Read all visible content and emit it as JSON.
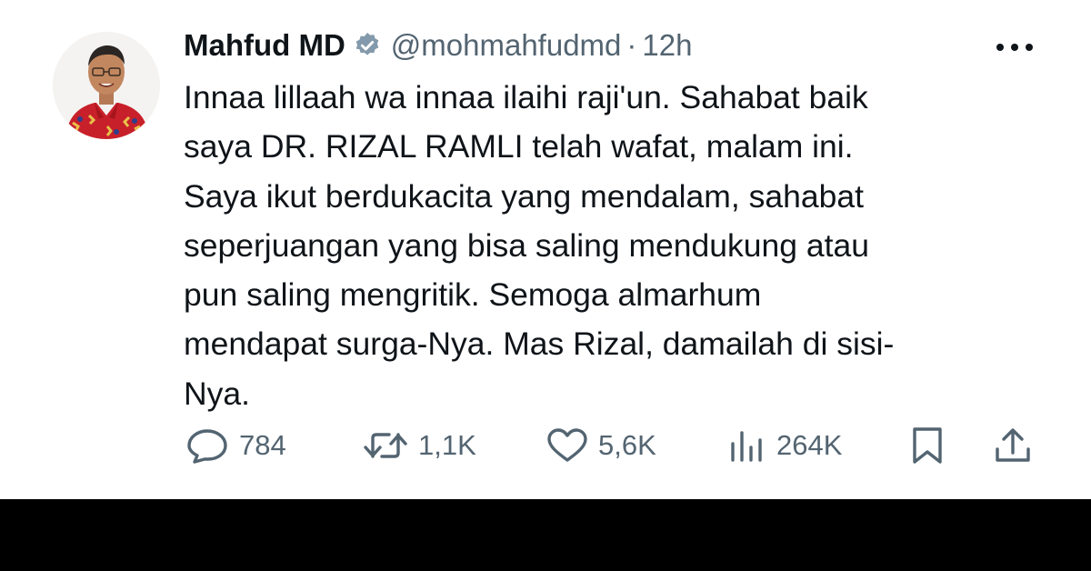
{
  "tweet": {
    "author_name": "Mahfud MD",
    "handle": "@mohmahfudmd",
    "separator": "·",
    "time": "12h",
    "text_lines": [
      "Innaa lillaah wa innaa ilaihi raji'un. Sahabat baik",
      "saya DR. RIZAL RAMLI telah wafat, malam ini.",
      "Saya ikut berdukacita yang mendalam, sahabat",
      "seperjuangan yang bisa saling mendukung atau",
      "pun saling mengritik. Semoga almarhum",
      "mendapat surga-Nya. Mas Rizal, damailah di sisi-",
      "Nya."
    ]
  },
  "actions": {
    "replies": "784",
    "reposts": "1,1K",
    "likes": "5,6K",
    "views": "264K"
  },
  "icons": {
    "verified": "verified-badge-icon",
    "more": "more-dots-icon",
    "reply": "reply-bubble-icon",
    "repost": "repost-arrows-icon",
    "like": "heart-icon",
    "views": "bar-chart-icon",
    "bookmark": "bookmark-icon",
    "share": "share-upload-icon"
  },
  "colors": {
    "text_primary": "#0f1419",
    "text_secondary": "#536471",
    "background": "#ffffff",
    "bottom_band": "#000000",
    "avatar_shirt": "#c8202a"
  }
}
